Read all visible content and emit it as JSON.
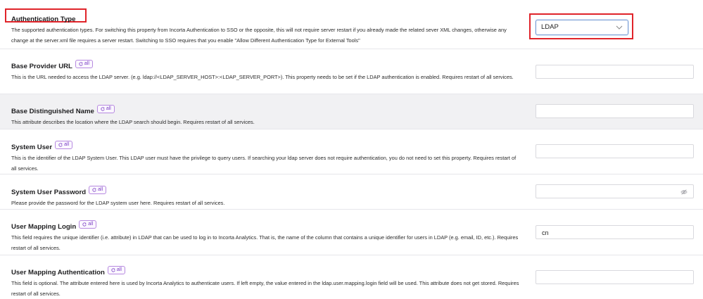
{
  "settings": [
    {
      "title": "Authentication Type",
      "description": "The supported authentication types. For switching this property from Incorta Authentication to SSO or the opposite, this will not require server restart if you already made the related sever XML changes, otherwise any change at the server.xml file requires a server restart. Switching to SSO requires that you enable \"Allow Different Authentication Type for External Tools\"",
      "value": "LDAP"
    },
    {
      "title": "Base Provider URL",
      "badge": "all",
      "description": "This is the URL needed to access the LDAP server. (e.g. ldap://<LDAP_SERVER_HOST>:<LDAP_SERVER_PORT>). This property needs to be set if the LDAP authentication is enabled. Requires restart of all services.",
      "value": ""
    },
    {
      "title": "Base Distinguished Name",
      "badge": "all",
      "description": "This attribute describes the location where the LDAP search should begin. Requires restart of all services.",
      "value": ""
    },
    {
      "title": "System User",
      "badge": "all",
      "description": "This is the identifier of the LDAP System User. This LDAP user must have the privilege to query users. If searching your ldap server does not require authentication, you do not need to set this property. Requires restart of all services.",
      "value": ""
    },
    {
      "title": "System User Password",
      "badge": "all",
      "description": "Please provide the password for the LDAP system user here. Requires restart of all services.",
      "value": ""
    },
    {
      "title": "User Mapping Login",
      "badge": "all",
      "description": "This field requires the unique identifier (i.e. attribute) in LDAP that can be used to log in to Incorta Analytics. That is, the name of the column that contains a unique identifier for users in LDAP (e.g. email, ID, etc.). Requires restart of all services.",
      "value": "cn"
    },
    {
      "title": "User Mapping Authentication",
      "badge": "all",
      "description": "This field is optional. The attribute entered here is used by Incorta Analytics to authenticate users. If left empty, the value entered in the ldap.user.mapping.login field will be used. This attribute does not get stored. Requires restart of all services.",
      "value": ""
    }
  ],
  "icons": {
    "badge_icon": "refresh-icon",
    "select_icon": "chevron-down-icon",
    "password_icon": "eye-off-icon"
  }
}
